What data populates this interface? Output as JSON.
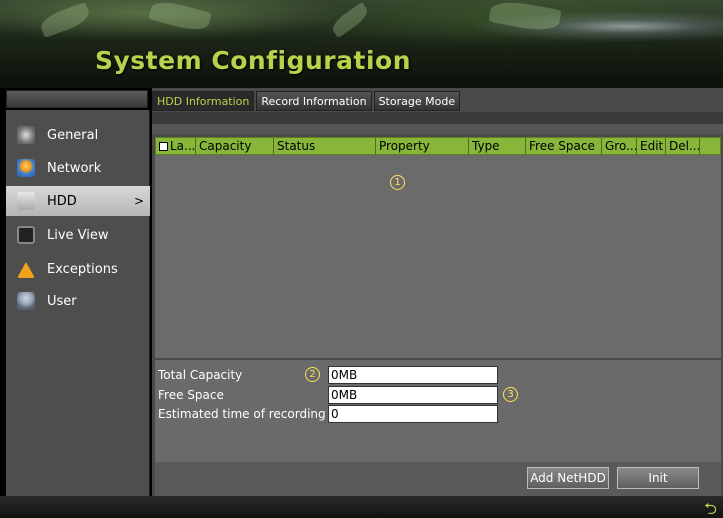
{
  "header": {
    "title": "System Configuration"
  },
  "sidebar": {
    "items": [
      {
        "label": "General",
        "icon": "gear-icon"
      },
      {
        "label": "Network",
        "icon": "globe-icon"
      },
      {
        "label": "HDD",
        "icon": "hdd-icon",
        "active": true,
        "chevron": ">"
      },
      {
        "label": "Live View",
        "icon": "monitor-icon"
      },
      {
        "label": "Exceptions",
        "icon": "warning-icon"
      },
      {
        "label": "User",
        "icon": "user-icon"
      }
    ]
  },
  "tabs": [
    {
      "label": "HDD Information",
      "active": true
    },
    {
      "label": "Record Information"
    },
    {
      "label": "Storage Mode"
    }
  ],
  "table": {
    "columns": [
      "La...",
      "Capacity",
      "Status",
      "Property",
      "Type",
      "Free Space",
      "Gro...",
      "Edit",
      "Del..."
    ],
    "rows": []
  },
  "markers": {
    "one": "1",
    "two": "2",
    "three": "3"
  },
  "fields": {
    "total_capacity": {
      "label": "Total Capacity",
      "value": "0MB"
    },
    "free_space": {
      "label": "Free Space",
      "value": "0MB"
    },
    "estimated_time": {
      "label": "Estimated time of recording ...",
      "value": "0"
    }
  },
  "buttons": {
    "add_net_hdd": "Add NetHDD",
    "init": "Init"
  },
  "footer": {
    "back_icon": "back-arrow-icon"
  },
  "colors": {
    "accent": "#b6d34c",
    "header_row": "#88b63a",
    "marker": "#ffe25a"
  }
}
